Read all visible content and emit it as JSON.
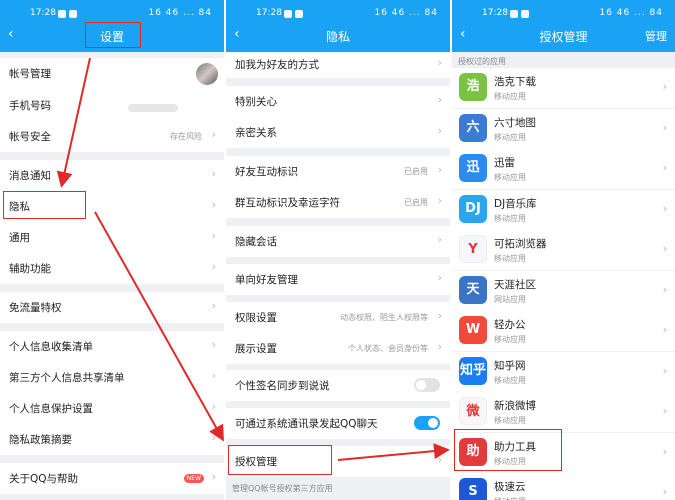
{
  "status": {
    "time": "17:28",
    "right": "16 46 ... 84"
  },
  "panel1": {
    "title": "设置",
    "items": [
      "帐号管理",
      "手机号码",
      "帐号安全",
      "消息通知",
      "隐私",
      "通用",
      "辅助功能",
      "免流量特权",
      "个人信息收集清单",
      "第三方个人信息共享清单",
      "个人信息保护设置",
      "隐私政策摘要",
      "关于QQ与帮助"
    ],
    "account_security_value": "存在风险",
    "new_badge": "NEW"
  },
  "panel2": {
    "title": "隐私",
    "items": [
      "加我为好友的方式",
      "特别关心",
      "亲密关系",
      "好友互动标识",
      "群互动标识及幸运字符",
      "隐藏会话",
      "单向好友管理",
      "权限设置",
      "展示设置",
      "个性签名同步到说说",
      "可通过系统通讯录发起QQ聊天",
      "授权管理"
    ],
    "values": {
      "friend_mark": "已启用",
      "group_mark": "已启用",
      "permission": "动态权限、陌生人权限等",
      "display": "个人状态、会员身份等"
    },
    "footer": "管理QQ帐号授权第三方应用",
    "toggles": {
      "signature_sync": false,
      "contacts_chat": true
    }
  },
  "panel3": {
    "title": "授权管理",
    "manage": "管理",
    "section": "授权过的应用",
    "apps": [
      {
        "name": "浩克下载",
        "sub": "移动应用",
        "glyph": "浩",
        "color": "#7cc242"
      },
      {
        "name": "六寸地图",
        "sub": "移动应用",
        "glyph": "六",
        "color": "#3a7bd5"
      },
      {
        "name": "迅雷",
        "sub": "移动应用",
        "glyph": "迅",
        "color": "#2a8cf0"
      },
      {
        "name": "DJ音乐库",
        "sub": "移动应用",
        "glyph": "DJ",
        "color": "#29a6f0"
      },
      {
        "name": "可拓浏览器",
        "sub": "移动应用",
        "glyph": "Y",
        "color": "#f5f7fa"
      },
      {
        "name": "天涯社区",
        "sub": "网站应用",
        "glyph": "天",
        "color": "#3a74c4"
      },
      {
        "name": "轻办公",
        "sub": "移动应用",
        "glyph": "W",
        "color": "#f04a3a"
      },
      {
        "name": "知乎网",
        "sub": "移动应用",
        "glyph": "知乎",
        "color": "#1a7ef2"
      },
      {
        "name": "新浪微博",
        "sub": "移动应用",
        "glyph": "微",
        "color": "#f7f7f7"
      },
      {
        "name": "助力工具",
        "sub": "移动应用",
        "glyph": "助",
        "color": "#e23b3b"
      },
      {
        "name": "极速云",
        "sub": "移动应用",
        "glyph": "S",
        "color": "#1d58d8"
      }
    ]
  }
}
